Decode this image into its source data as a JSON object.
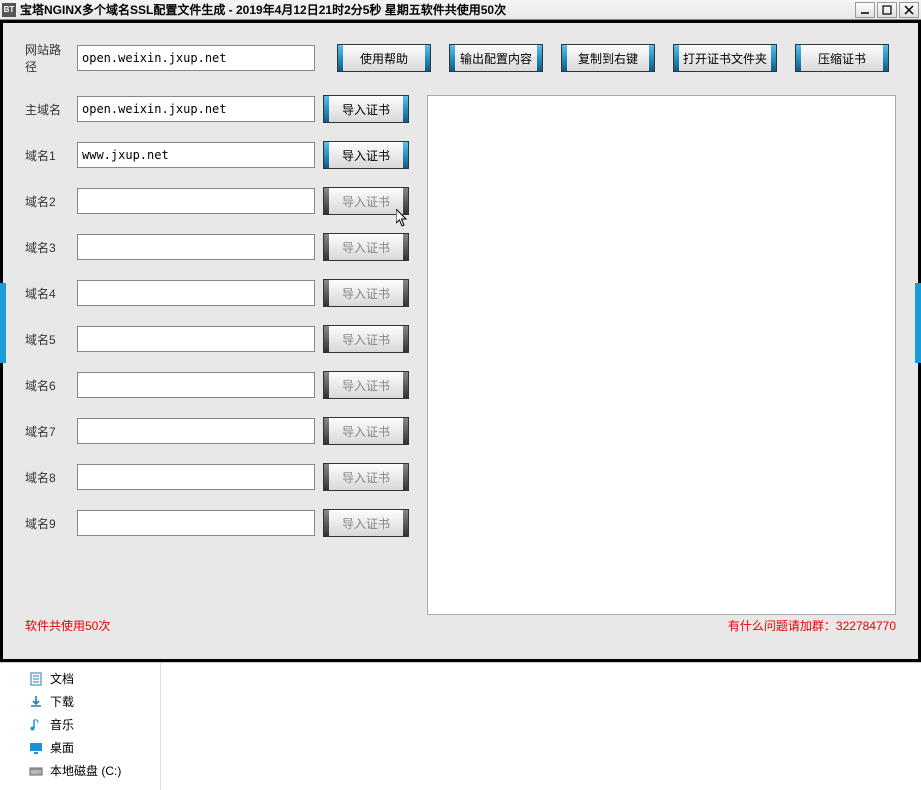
{
  "window": {
    "icon_text": "BT",
    "title": "宝塔NGINX多个域名SSL配置文件生成 - 2019年4月12日21时2分5秒 星期五软件共使用50次"
  },
  "labels": {
    "site_path": "网站路径",
    "main_domain": "主域名",
    "domain_prefix": "域名"
  },
  "inputs": {
    "site_path": "open.weixin.jxup.net",
    "main_domain": "open.weixin.jxup.net",
    "domains": [
      "www.jxup.net",
      "",
      "",
      "",
      "",
      "",
      "",
      "",
      ""
    ]
  },
  "buttons": {
    "help": "使用帮助",
    "output_config": "输出配置内容",
    "copy_right": "复制到右键",
    "open_cert_folder": "打开证书文件夹",
    "compress_cert": "压缩证书",
    "import_cert": "导入证书"
  },
  "footer": {
    "usage": "软件共使用50次",
    "contact": "有什么问题请加群：322784770"
  },
  "explorer": {
    "items": [
      {
        "label": "文档",
        "icon": "doc"
      },
      {
        "label": "下载",
        "icon": "download"
      },
      {
        "label": "音乐",
        "icon": "music"
      },
      {
        "label": "桌面",
        "icon": "desktop"
      },
      {
        "label": "本地磁盘 (C:)",
        "icon": "disk"
      }
    ]
  }
}
